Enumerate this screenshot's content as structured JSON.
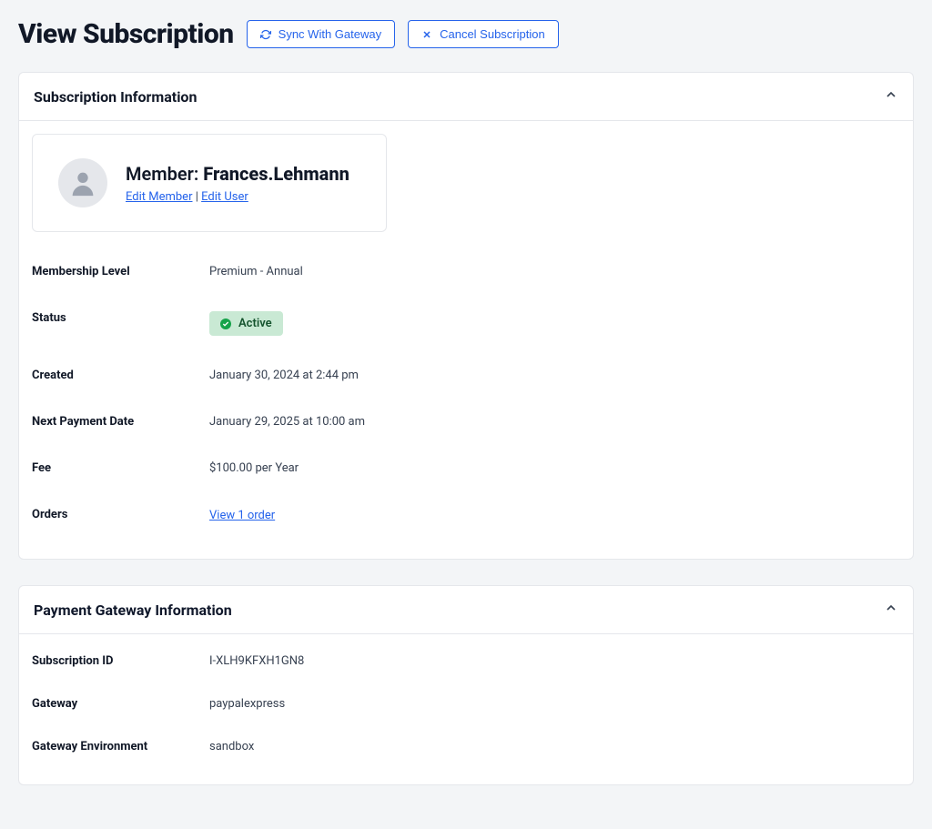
{
  "page": {
    "title": "View Subscription",
    "sync_label": "Sync With Gateway",
    "cancel_label": "Cancel Subscription"
  },
  "subscription_panel": {
    "title": "Subscription Information",
    "member_prefix": "Member: ",
    "member_name": "Frances.Lehmann",
    "edit_member_label": "Edit Member",
    "edit_user_label": "Edit User",
    "sep": " | ",
    "rows": {
      "membership_level_label": "Membership Level",
      "membership_level_value": "Premium - Annual",
      "status_label": "Status",
      "status_value": "Active",
      "created_label": "Created",
      "created_value": "January 30, 2024 at 2:44 pm",
      "next_payment_label": "Next Payment Date",
      "next_payment_value": "January 29, 2025 at 10:00 am",
      "fee_label": "Fee",
      "fee_value": "$100.00 per Year",
      "orders_label": "Orders",
      "orders_link": "View 1 order"
    }
  },
  "gateway_panel": {
    "title": "Payment Gateway Information",
    "rows": {
      "subscription_id_label": "Subscription ID",
      "subscription_id_value": "I-XLH9KFXH1GN8",
      "gateway_label": "Gateway",
      "gateway_value": "paypalexpress",
      "env_label": "Gateway Environment",
      "env_value": "sandbox"
    }
  }
}
